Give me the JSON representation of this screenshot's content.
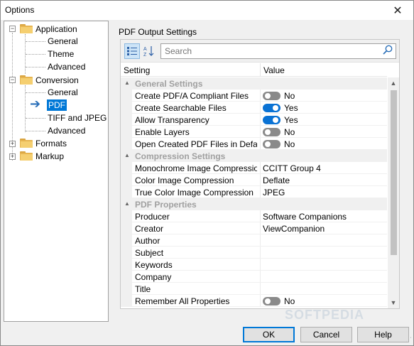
{
  "window": {
    "title": "Options",
    "close_glyph": "✕"
  },
  "tree": {
    "application": {
      "label": "Application",
      "children": [
        "General",
        "Theme",
        "Advanced"
      ]
    },
    "conversion": {
      "label": "Conversion",
      "children": [
        "General",
        "PDF",
        "TIFF and JPEG",
        "Advanced"
      ]
    },
    "formats": {
      "label": "Formats"
    },
    "markup": {
      "label": "Markup"
    },
    "selected": "PDF"
  },
  "panel": {
    "title": "PDF Output Settings",
    "search_placeholder": "Search",
    "col_setting": "Setting",
    "col_value": "Value"
  },
  "rows": [
    {
      "type": "category",
      "name": "General Settings"
    },
    {
      "type": "toggle",
      "name": "Create PDF/A Compliant Files",
      "state": "off",
      "value": "No"
    },
    {
      "type": "toggle",
      "name": "Create Searchable Files",
      "state": "on",
      "value": "Yes"
    },
    {
      "type": "toggle",
      "name": "Allow Transparency",
      "state": "on",
      "value": "Yes"
    },
    {
      "type": "toggle",
      "name": "Enable Layers",
      "state": "off",
      "value": "No"
    },
    {
      "type": "toggle",
      "name": "Open Created PDF Files in Default...",
      "state": "off",
      "value": "No"
    },
    {
      "type": "category",
      "name": "Compression Settings"
    },
    {
      "type": "text",
      "name": "Monochrome Image Compression",
      "value": "CCITT Group 4"
    },
    {
      "type": "text",
      "name": "Color Image Compression",
      "value": "Deflate"
    },
    {
      "type": "text",
      "name": "True Color Image Compression",
      "value": "JPEG"
    },
    {
      "type": "category",
      "name": "PDF Properties"
    },
    {
      "type": "text",
      "name": "Producer",
      "value": "Software Companions"
    },
    {
      "type": "text",
      "name": "Creator",
      "value": "ViewCompanion"
    },
    {
      "type": "text",
      "name": "Author",
      "value": ""
    },
    {
      "type": "text",
      "name": "Subject",
      "value": ""
    },
    {
      "type": "text",
      "name": "Keywords",
      "value": ""
    },
    {
      "type": "text",
      "name": "Company",
      "value": ""
    },
    {
      "type": "text",
      "name": "Title",
      "value": ""
    },
    {
      "type": "toggle",
      "name": "Remember All Properties",
      "state": "off",
      "value": "No"
    }
  ],
  "buttons": {
    "ok": "OK",
    "cancel": "Cancel",
    "help": "Help"
  },
  "watermark": "SOFTPEDIA",
  "colors": {
    "accent": "#0078d7",
    "toggle_on": "#0a72d4",
    "toggle_off": "#8a8a8a"
  }
}
